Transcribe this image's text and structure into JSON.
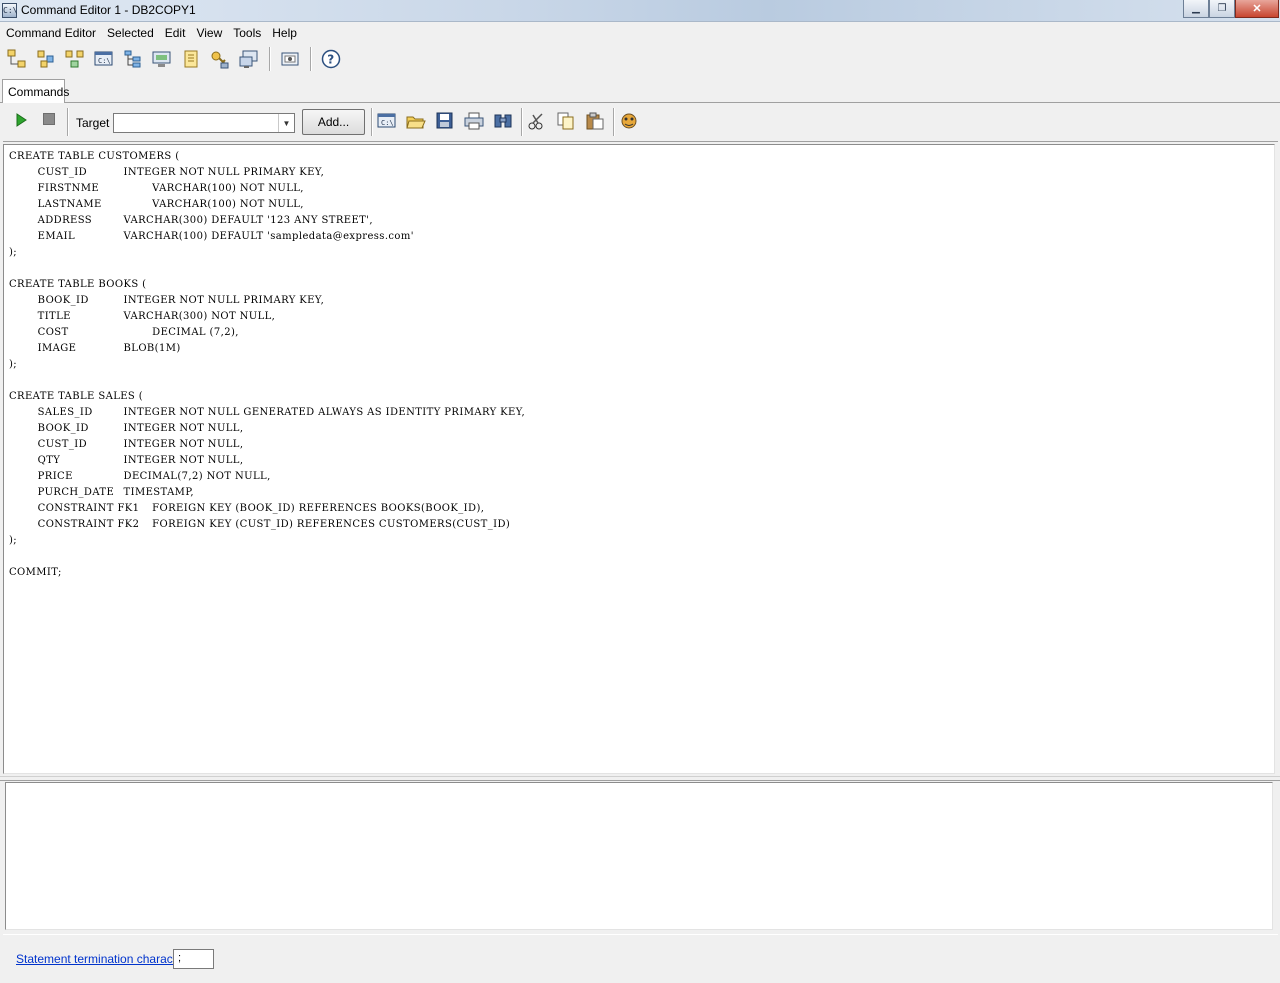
{
  "window": {
    "title": "Command Editor 1 - DB2COPY1",
    "icon_text": "C:\\",
    "minimize": "▁",
    "maximize": "❐",
    "close": "✕"
  },
  "menu": [
    "Command Editor",
    "Selected",
    "Edit",
    "View",
    "Tools",
    "Help"
  ],
  "tabs": {
    "commands": "Commands"
  },
  "command_toolbar": {
    "target_label": "Target",
    "target_value": "",
    "add_label": "Add..."
  },
  "editor": {
    "lines": [
      "CREATE TABLE CUSTOMERS (",
      "\tCUST_ID\t\tINTEGER NOT NULL PRIMARY KEY,",
      "\tFIRSTNME\t\tVARCHAR(100) NOT NULL,",
      "\tLASTNAME\t\tVARCHAR(100) NOT NULL,",
      "\tADDRESS\t\tVARCHAR(300) DEFAULT '123 ANY STREET',",
      "\tEMAIL\t\tVARCHAR(100) DEFAULT 'sampledata@express.com'",
      ");",
      "",
      "CREATE TABLE BOOKS (",
      "\tBOOK_ID\t\tINTEGER NOT NULL PRIMARY KEY,",
      "\tTITLE\t\tVARCHAR(300) NOT NULL,",
      "\tCOST\t\t\tDECIMAL (7,2),",
      "\tIMAGE\t\tBLOB(1M)",
      ");",
      "",
      "CREATE TABLE SALES (",
      "\tSALES_ID\t\tINTEGER NOT NULL GENERATED ALWAYS AS IDENTITY PRIMARY KEY,",
      "\tBOOK_ID\t\tINTEGER NOT NULL,",
      "\tCUST_ID\t\tINTEGER NOT NULL,",
      "\tQTY\t\t\tINTEGER NOT NULL,",
      "\tPRICE\t\tDECIMAL(7,2) NOT NULL,",
      "\tPURCH_DATE\tTIMESTAMP,",
      "\tCONSTRAINT FK1\tFOREIGN KEY (BOOK_ID) REFERENCES BOOKS(BOOK_ID),",
      "\tCONSTRAINT FK2\tFOREIGN KEY (CUST_ID) REFERENCES CUSTOMERS(CUST_ID)",
      ");",
      "",
      "COMMIT;"
    ]
  },
  "output": {
    "text": ""
  },
  "status": {
    "termination_label": "Statement termination character",
    "termination_value": ";"
  },
  "colors": {
    "link": "#0033cc",
    "run_green": "#2ea52e"
  }
}
